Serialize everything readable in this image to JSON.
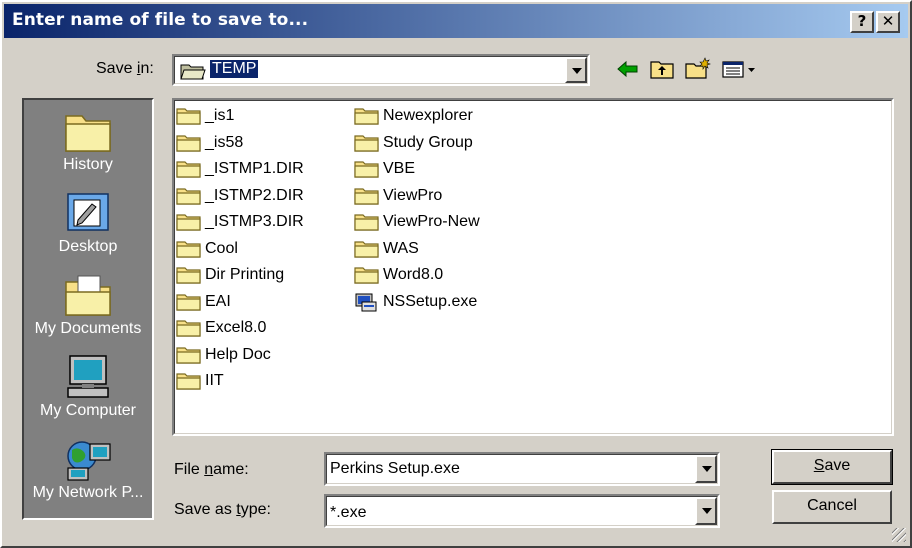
{
  "window": {
    "title": "Enter name of file to save to...",
    "help_btn": "?",
    "close_btn": "✕"
  },
  "save_in": {
    "label_pre": "Save ",
    "label_key": "i",
    "label_post": "n:",
    "value": "TEMP"
  },
  "toolbar": {
    "back": "back-arrow-icon",
    "up": "up-one-level-icon",
    "new_folder": "new-folder-icon",
    "view_menu": "view-menu-icon"
  },
  "places": [
    {
      "label": "History",
      "icon": "history-folder-icon"
    },
    {
      "label": "Desktop",
      "icon": "desktop-icon"
    },
    {
      "label": "My Documents",
      "icon": "my-documents-icon"
    },
    {
      "label": "My Computer",
      "icon": "my-computer-icon"
    },
    {
      "label": "My Network P...",
      "icon": "network-places-icon"
    }
  ],
  "files": {
    "col1": [
      "_is1",
      "_is58",
      "_ISTMP1.DIR",
      "_ISTMP2.DIR",
      "_ISTMP3.DIR",
      "Cool",
      "Dir Printing",
      "EAI",
      "Excel8.0",
      "Help Doc",
      "IIT"
    ],
    "col2": [
      "Newexplorer",
      "Study Group",
      "VBE",
      "ViewPro",
      "ViewPro-New",
      "WAS",
      "Word8.0"
    ],
    "exe": "NSSetup.exe"
  },
  "filename": {
    "label_pre": "File ",
    "label_key": "n",
    "label_post": "ame:",
    "value": "Perkins Setup.exe"
  },
  "filetype": {
    "label_pre": "Save as ",
    "label_key": "t",
    "label_post": "ype:",
    "value": "*.exe"
  },
  "buttons": {
    "save_key": "S",
    "save_rest": "ave",
    "cancel": "Cancel"
  },
  "colors": {
    "title_start": "#0a246a",
    "title_end": "#a6caf0",
    "face": "#d4d0c8",
    "folder": "#f8e088"
  }
}
